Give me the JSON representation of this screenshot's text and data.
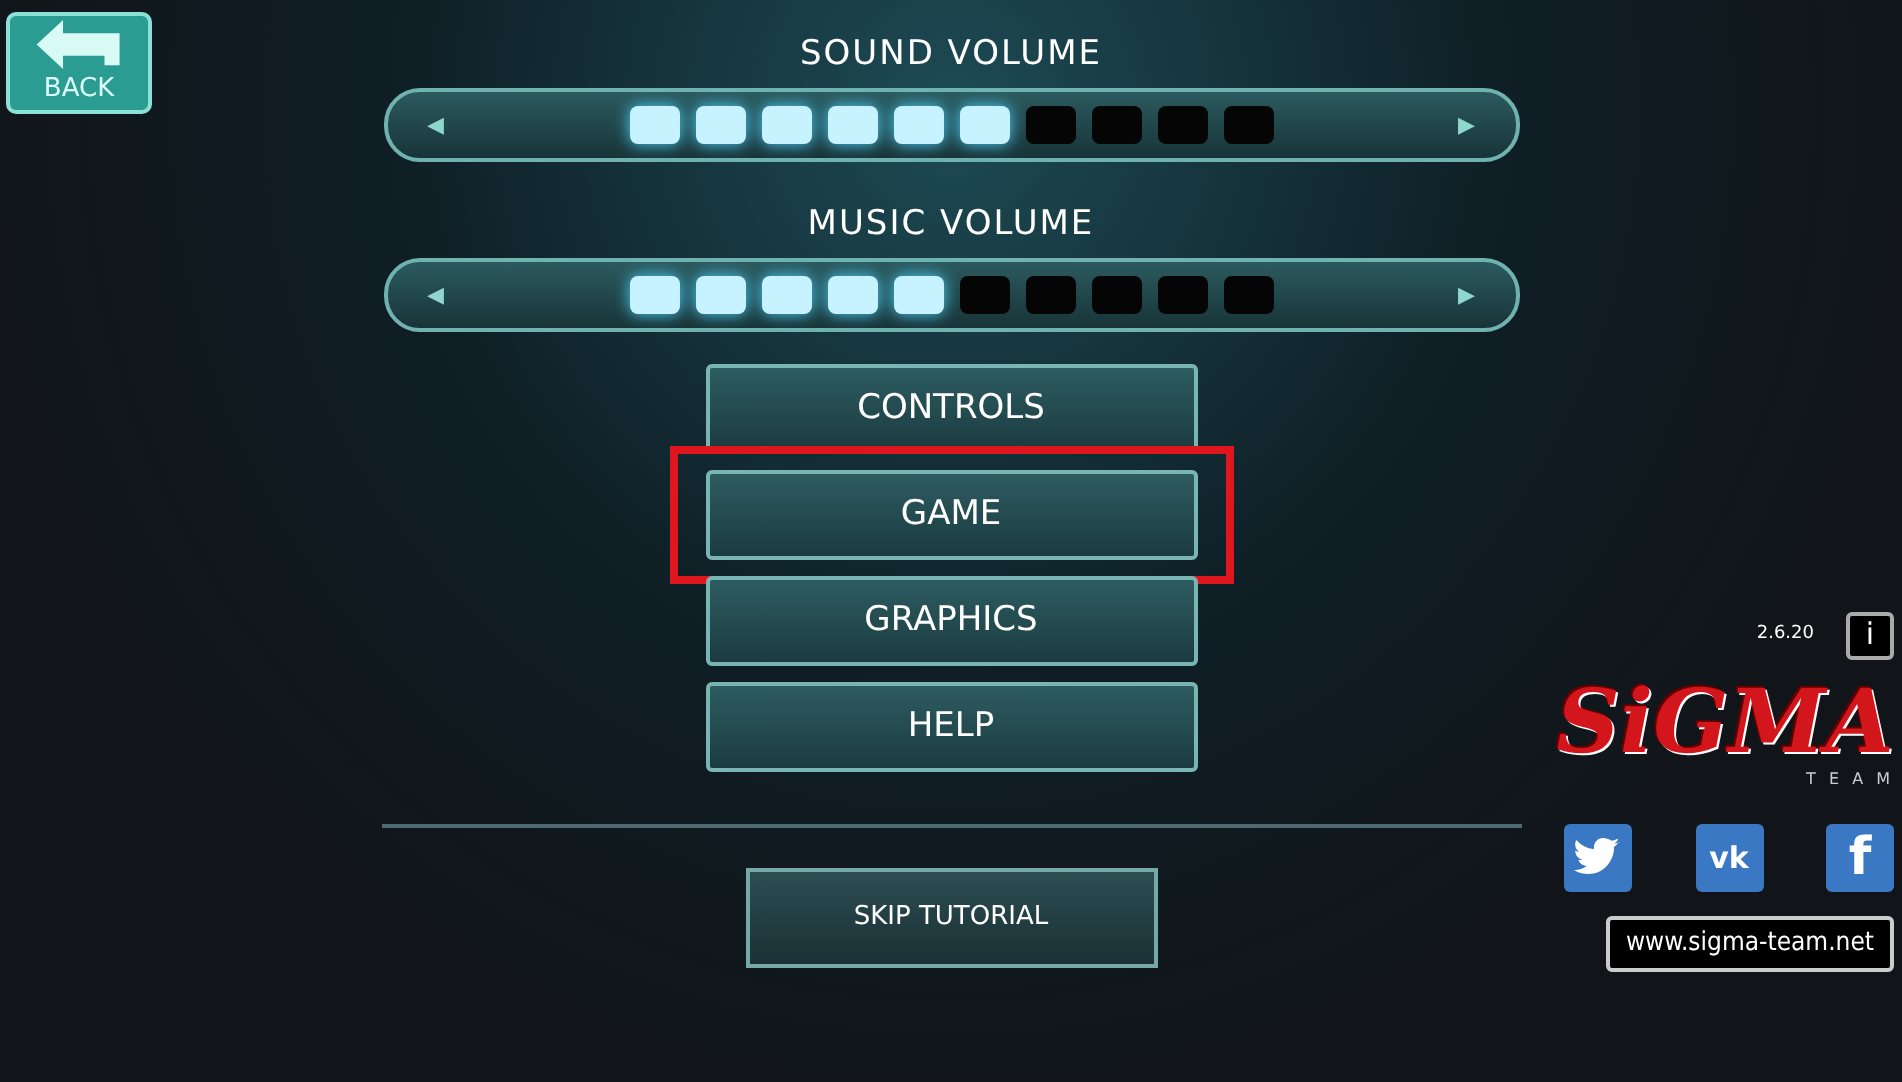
{
  "back_button": {
    "label": "BACK"
  },
  "sliders": [
    {
      "title": "SOUND VOLUME",
      "left_arrow": "◀",
      "right_arrow": "▶",
      "segments": [
        {
          "lit": true
        },
        {
          "lit": true
        },
        {
          "lit": true
        },
        {
          "lit": true
        },
        {
          "lit": true
        },
        {
          "lit": true
        },
        {
          "lit": false
        },
        {
          "lit": false
        },
        {
          "lit": false
        },
        {
          "lit": false
        }
      ]
    },
    {
      "title": "MUSIC VOLUME",
      "left_arrow": "◀",
      "right_arrow": "▶",
      "segments": [
        {
          "lit": true
        },
        {
          "lit": true
        },
        {
          "lit": true
        },
        {
          "lit": true
        },
        {
          "lit": true
        },
        {
          "lit": false
        },
        {
          "lit": false
        },
        {
          "lit": false
        },
        {
          "lit": false
        },
        {
          "lit": false
        }
      ]
    }
  ],
  "menu": [
    {
      "label": "CONTROLS",
      "highlighted": false
    },
    {
      "label": "GAME",
      "highlighted": true
    },
    {
      "label": "GRAPHICS",
      "highlighted": false
    },
    {
      "label": "HELP",
      "highlighted": false
    }
  ],
  "skip_button": {
    "label": "SKIP TUTORIAL"
  },
  "version": "2.6.20",
  "info_button": "i",
  "logo": {
    "title": "SiGMA",
    "subtitle": "T E A M"
  },
  "social": [
    {
      "kind": "twitter"
    },
    {
      "kind": "vk",
      "label": "vk"
    },
    {
      "kind": "facebook",
      "label": "f"
    }
  ],
  "website": "www.sigma-team.net"
}
